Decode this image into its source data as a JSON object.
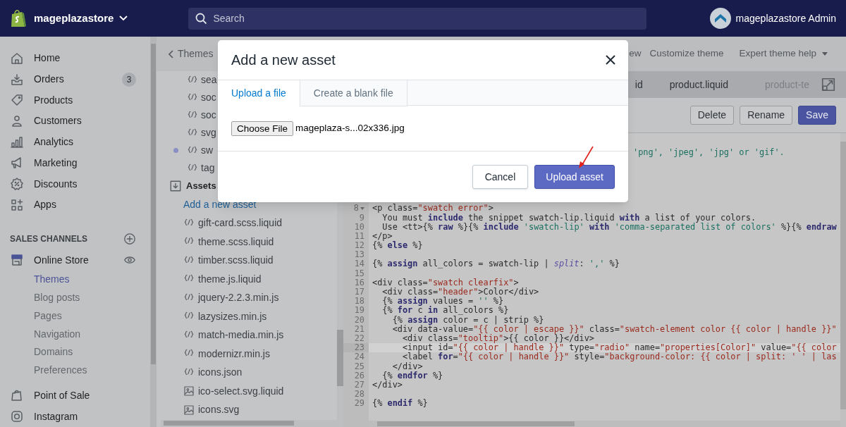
{
  "top_bar": {
    "store_name": "mageplazastore",
    "search": {
      "placeholder": "Search"
    },
    "account": "mageplazastore Admin"
  },
  "sidebar": {
    "items": [
      {
        "label": "Home",
        "selected": false
      },
      {
        "label": "Orders",
        "badge": "3",
        "selected": false
      },
      {
        "label": "Products",
        "selected": false
      },
      {
        "label": "Customers",
        "selected": false
      },
      {
        "label": "Analytics",
        "selected": false
      },
      {
        "label": "Marketing",
        "selected": false
      },
      {
        "label": "Discounts",
        "selected": false
      },
      {
        "label": "Apps",
        "selected": false
      }
    ],
    "sales_channels": {
      "title": "SALES CHANNELS",
      "channels": [
        {
          "label": "Online Store",
          "children": [
            {
              "label": "Themes",
              "selected": true
            },
            {
              "label": "Blog posts",
              "selected": false
            },
            {
              "label": "Pages",
              "selected": false
            },
            {
              "label": "Navigation",
              "selected": false
            },
            {
              "label": "Domains",
              "selected": false
            },
            {
              "label": "Preferences",
              "selected": false
            }
          ]
        },
        {
          "label": "Point of Sale"
        },
        {
          "label": "Instagram"
        }
      ]
    }
  },
  "editor_header": {
    "back_link": "Themes",
    "actions": [
      {
        "label": "ew",
        "dropdown": false
      },
      {
        "label": "Customize theme",
        "dropdown": false
      },
      {
        "label": "Expert theme help",
        "dropdown": true
      }
    ]
  },
  "file_panel": {
    "top_files": [
      {
        "name": "sea",
        "modified": false
      },
      {
        "name": "soc",
        "modified": false
      },
      {
        "name": "soc",
        "modified": false
      },
      {
        "name": "svg",
        "modified": false
      },
      {
        "name": "sw",
        "modified": true
      },
      {
        "name": "tag",
        "modified": false
      }
    ],
    "assets": {
      "title": "Assets",
      "add_link": "Add a new asset",
      "files": [
        {
          "name": "gift-card.scss.liquid",
          "kind": "code"
        },
        {
          "name": "theme.scss.liquid",
          "kind": "code"
        },
        {
          "name": "timber.scss.liquid",
          "kind": "code"
        },
        {
          "name": "theme.js.liquid",
          "kind": "code"
        },
        {
          "name": "jquery-2.2.3.min.js",
          "kind": "code"
        },
        {
          "name": "lazysizes.min.js",
          "kind": "code"
        },
        {
          "name": "match-media.min.js",
          "kind": "code"
        },
        {
          "name": "modernizr.min.js",
          "kind": "code"
        },
        {
          "name": "icons.json",
          "kind": "code"
        },
        {
          "name": "ico-select.svg.liquid",
          "kind": "image"
        },
        {
          "name": "icons.svg",
          "kind": "image"
        }
      ]
    }
  },
  "editor": {
    "tabs": [
      {
        "label": "id",
        "faded": false
      },
      {
        "label": "product.liquid",
        "faded": false
      },
      {
        "label": "product-te",
        "faded": true
      }
    ],
    "buttons": [
      {
        "label": "Delete",
        "kind": "default"
      },
      {
        "label": "Rename",
        "kind": "default"
      },
      {
        "label": "Save",
        "kind": "primary"
      }
    ],
    "code_fragment": "'png', 'jpeg', 'jpg' or 'gif'.",
    "code_lines": [
      {
        "number": "8",
        "text": "<p class=\"swatch error\">",
        "foldable": true,
        "active": false
      },
      {
        "number": "9",
        "text": "  You must include the snippet swatch-lip.liquid with a list of your colors.",
        "foldable": false,
        "active": false
      },
      {
        "number": "10",
        "text": "  Use <tt>{% raw %}{% include 'swatch-lip' with 'comma-separated list of colors' %}{% endraw",
        "foldable": false,
        "active": false
      },
      {
        "number": "11",
        "text": "</p>",
        "foldable": false,
        "active": false
      },
      {
        "number": "12",
        "text": "{% else %}",
        "foldable": false,
        "active": false
      },
      {
        "number": "13",
        "foldable": false,
        "active": false
      },
      {
        "number": "14",
        "text": "{% assign all_colors = swatch-lip | split: ',' %}",
        "foldable": false,
        "active": false
      },
      {
        "number": "15",
        "foldable": false,
        "active": false
      },
      {
        "number": "16",
        "text": "<div class=\"swatch clearfix\">",
        "foldable": false,
        "active": false
      },
      {
        "number": "17",
        "text": "  <div class=\"header\">Color</div>",
        "foldable": false,
        "active": false
      },
      {
        "number": "18",
        "text": "  {% assign values = '' %}",
        "foldable": false,
        "active": false
      },
      {
        "number": "19",
        "text": "  {% for c in all_colors %}",
        "foldable": false,
        "active": false
      },
      {
        "number": "20",
        "text": "    {% assign color = c | strip %}",
        "foldable": false,
        "active": false
      },
      {
        "number": "21",
        "text": "    <div data-value=\"{{ color | escape }}\" class=\"swatch-element color {{ color | handle }}\"",
        "foldable": false,
        "active": false
      },
      {
        "number": "22",
        "text": "      <div class=\"tooltip\">{{ color }}</div>",
        "foldable": false,
        "active": false
      },
      {
        "number": "23",
        "text": "      <input id=\"{{ color | handle }}\" type=\"radio\" name=\"properties[Color]\" value=\"{{ color",
        "foldable": false,
        "active": true
      },
      {
        "number": "24",
        "text": "      <label for=\"{{ color | handle }}\" style=\"background-color: {{ color | split: ' ' | las",
        "foldable": false,
        "active": false
      },
      {
        "number": "25",
        "text": "    </div>",
        "foldable": false,
        "active": false
      },
      {
        "number": "26",
        "text": "  {% endfor %}",
        "foldable": false,
        "active": false
      },
      {
        "number": "27",
        "text": "</div>",
        "foldable": false,
        "active": false
      },
      {
        "number": "28",
        "foldable": false,
        "active": false
      },
      {
        "number": "29",
        "text": "{% endif %}",
        "foldable": false,
        "active": false
      }
    ]
  },
  "modal": {
    "title": "Add a new asset",
    "tabs": [
      {
        "label": "Upload a file",
        "selected": true
      },
      {
        "label": "Create a blank file",
        "selected": false
      }
    ],
    "choose_button": "Choose File",
    "file_name": "mageplaza-s...02x336.jpg",
    "buttons": [
      {
        "label": "Cancel",
        "kind": "default"
      },
      {
        "label": "Upload asset",
        "kind": "primary"
      }
    ]
  }
}
